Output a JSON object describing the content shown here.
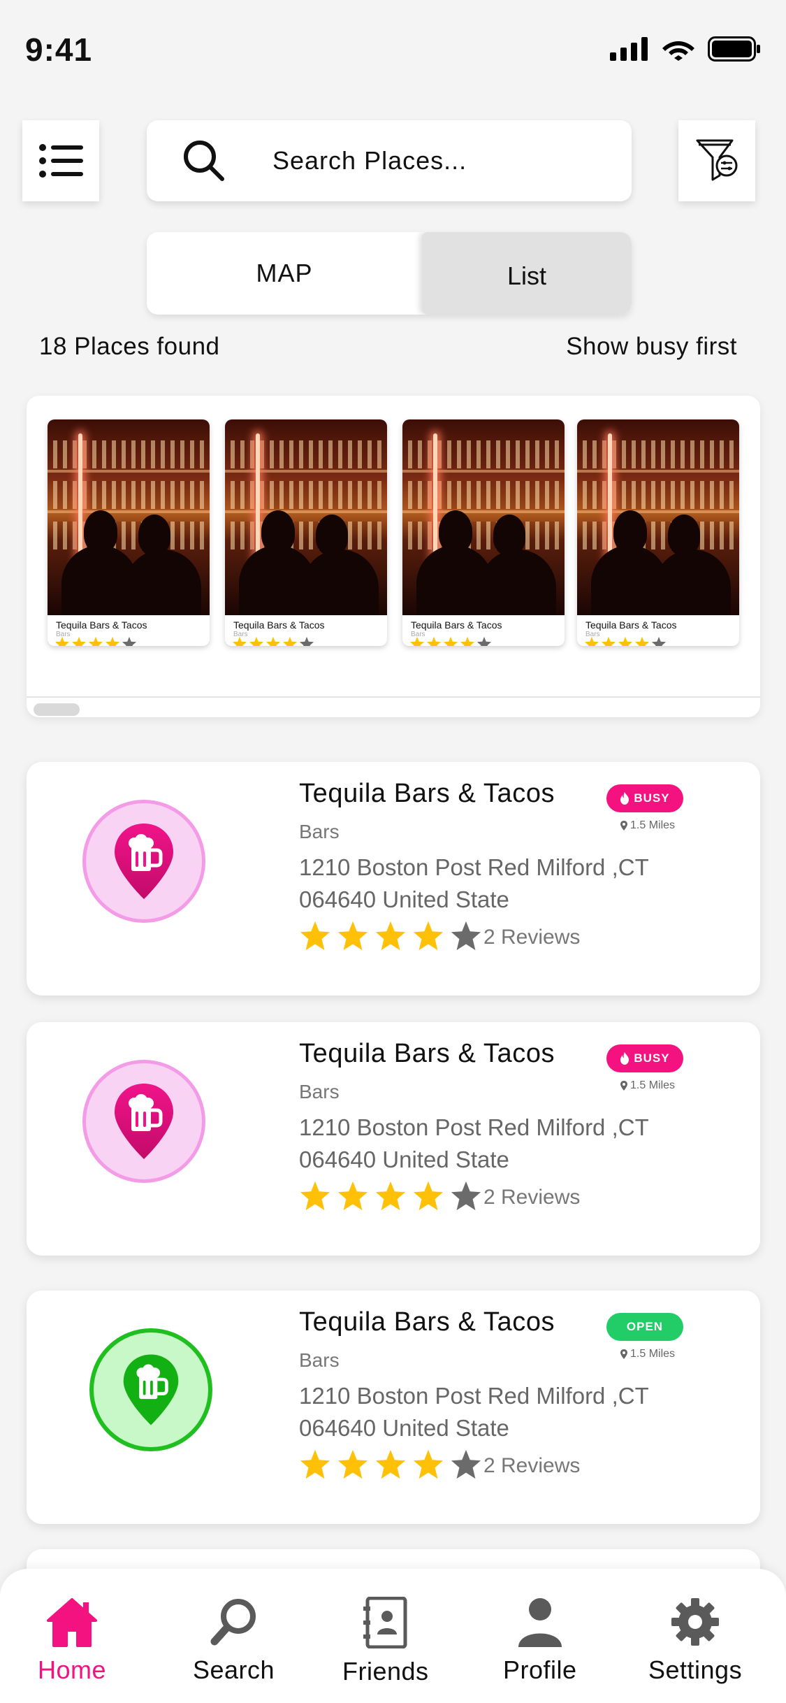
{
  "status_bar": {
    "time": "9:41"
  },
  "header": {
    "search_placeholder": "Search Places...",
    "icons": {
      "menu": "menu-icon",
      "search": "search-icon",
      "filter": "filter-icon"
    }
  },
  "view_toggle": {
    "map_label": "MAP",
    "list_label": "List",
    "selected": "List"
  },
  "results": {
    "count_label": "18 Places found",
    "sort_label": "Show busy first"
  },
  "carousel": {
    "items": [
      {
        "title": "Tequila Bars & Tacos",
        "category": "Bars",
        "rating": 4,
        "max_rating": 5
      },
      {
        "title": "Tequila Bars & Tacos",
        "category": "Bars",
        "rating": 4,
        "max_rating": 5
      },
      {
        "title": "Tequila Bars & Tacos",
        "category": "Bars",
        "rating": 4,
        "max_rating": 5
      },
      {
        "title": "Tequila Bars & Tacos",
        "category": "Bars",
        "rating": 4,
        "max_rating": 5
      }
    ]
  },
  "places": [
    {
      "title": "Tequila Bars & Tacos",
      "category": "Bars",
      "address": "1210 Boston Post Red Milford ,CT 064640 United State",
      "rating": 4,
      "reviews": "2 Reviews",
      "status": "BUSY",
      "distance": "1.5 Miles"
    },
    {
      "title": "Tequila Bars & Tacos",
      "category": "Bars",
      "address": "1210 Boston Post Red Milford ,CT 064640 United State",
      "rating": 4,
      "reviews": "2 Reviews",
      "status": "BUSY",
      "distance": "1.5 Miles"
    },
    {
      "title": "Tequila Bars & Tacos",
      "category": "Bars",
      "address": "1210 Boston Post Red Milford ,CT 064640 United State",
      "rating": 4,
      "reviews": "2 Reviews",
      "status": "OPEN",
      "distance": "1.5 Miles"
    }
  ],
  "tabbar": {
    "items": [
      {
        "label": "Home",
        "icon": "home-icon",
        "active": true
      },
      {
        "label": "Search",
        "icon": "search-icon",
        "active": false
      },
      {
        "label": "Friends",
        "icon": "contacts-icon",
        "active": false
      },
      {
        "label": "Profile",
        "icon": "user-icon",
        "active": false
      },
      {
        "label": "Settings",
        "icon": "gear-icon",
        "active": false
      }
    ]
  },
  "colors": {
    "accent_pink": "#f3127f",
    "open_green": "#22cc66",
    "star_gold": "#ffc107",
    "star_grey": "#6b6b6b"
  }
}
